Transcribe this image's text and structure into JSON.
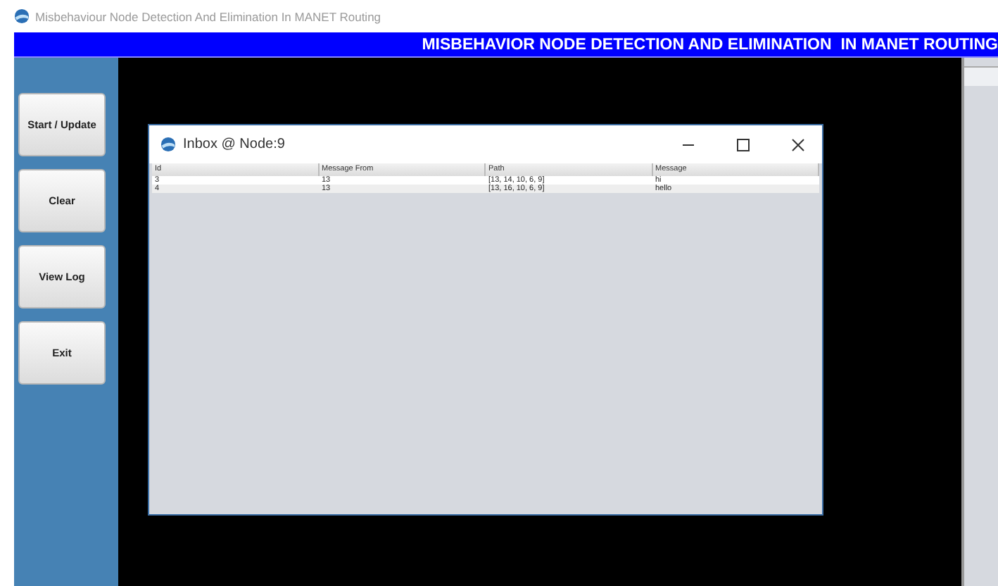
{
  "app_title": "Misbehaviour Node Detection And Elimination In MANET Routing",
  "header": "MISBEHAVIOR NODE DETECTION AND ELIMINATION  IN MANET ROUTING",
  "buttons": [
    "Start / Update",
    "Clear",
    "View Log",
    "Exit"
  ],
  "inbox": {
    "title": "Inbox @ Node:9",
    "columns": [
      "Id",
      "Message From",
      "Path",
      "Message"
    ],
    "rows": [
      [
        "3",
        "13",
        "[13, 14, 10, 6, 9]",
        "hi"
      ],
      [
        "4",
        "13",
        "[13, 16, 10, 6, 9]",
        "hello"
      ]
    ]
  }
}
